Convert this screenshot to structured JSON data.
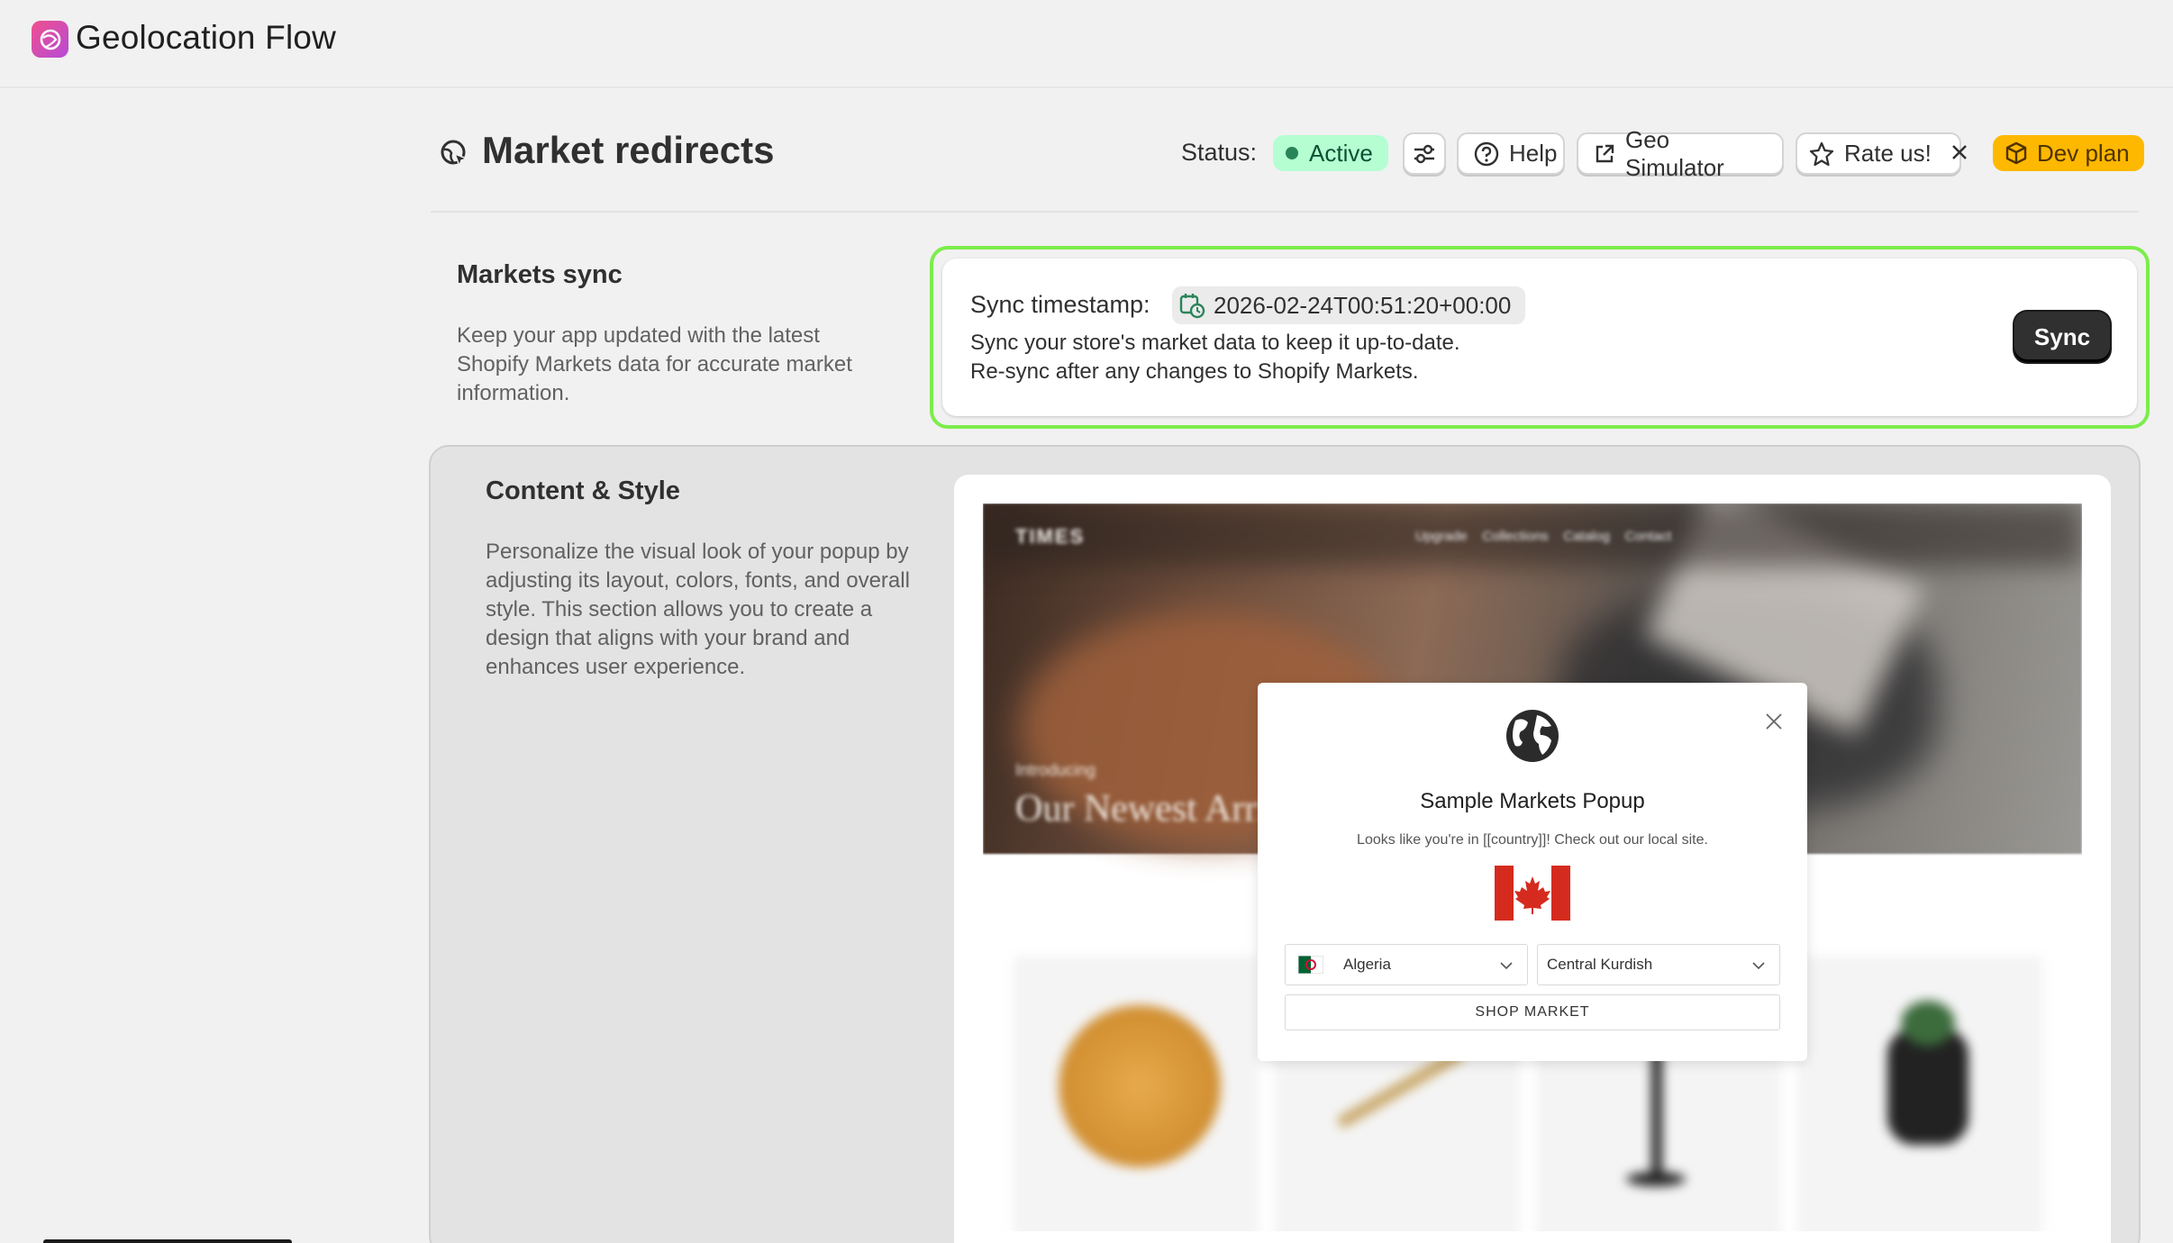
{
  "app": {
    "title": "Geolocation Flow"
  },
  "header": {
    "title": "Market redirects",
    "status_label": "Status:",
    "status_value": "Active",
    "help_label": "Help",
    "geo_simulator_label": "Geo Simulator",
    "rate_label": "Rate us!",
    "plan_label": "Dev plan"
  },
  "markets_sync": {
    "title": "Markets sync",
    "description": "Keep your app updated with the latest Shopify Markets data for accurate market information.",
    "timestamp_label": "Sync timestamp:",
    "timestamp_value": "2026-02-24T00:51:20+00:00",
    "line1": "Sync your store's market data to keep it up-to-date.",
    "line2": "Re-sync after any changes to Shopify Markets.",
    "sync_button": "Sync"
  },
  "content_style": {
    "title": "Content & Style",
    "description": "Personalize the visual look of your popup by adjusting its layout, colors, fonts, and overall style. This section allows you to create a design that aligns with your brand and enhances user experience."
  },
  "popup": {
    "title": "Sample Markets Popup",
    "text": "Looks like you're in [[country]]! Check out our local site.",
    "country_select": "Algeria",
    "language_select": "Central Kurdish",
    "shop_button": "SHOP MARKET"
  },
  "colors": {
    "active_badge_bg": "#b4fed2",
    "highlight_border": "#7ced4a",
    "dev_plan_bg": "#ffb800",
    "sync_button_bg": "#303030"
  },
  "icons": {
    "app_logo": "app-logo-icon",
    "page": "globe-cursor-icon",
    "settings": "sliders-icon",
    "help": "question-circle-icon",
    "geo_simulator": "external-link-icon",
    "rate": "star-icon",
    "close": "close-icon",
    "plan": "box-icon",
    "timestamp": "calendar-clock-icon"
  }
}
